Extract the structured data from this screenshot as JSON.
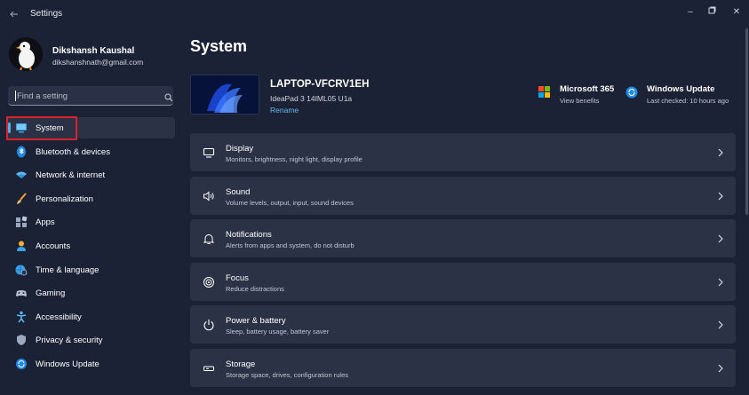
{
  "window": {
    "title": "Settings",
    "controls": {
      "minimize": "–",
      "maximize": "▢",
      "close": "✕"
    }
  },
  "profile": {
    "name": "Dikshansh Kaushal",
    "email": "dikshanshnath@gmail.com"
  },
  "search": {
    "placeholder": "Find a setting"
  },
  "sidebar": {
    "items": [
      {
        "label": "System",
        "icon": "system-icon",
        "selected": true
      },
      {
        "label": "Bluetooth & devices",
        "icon": "bluetooth-icon"
      },
      {
        "label": "Network & internet",
        "icon": "wifi-icon"
      },
      {
        "label": "Personalization",
        "icon": "brush-icon"
      },
      {
        "label": "Apps",
        "icon": "apps-icon"
      },
      {
        "label": "Accounts",
        "icon": "person-icon"
      },
      {
        "label": "Time & language",
        "icon": "globe-clock-icon"
      },
      {
        "label": "Gaming",
        "icon": "gamepad-icon"
      },
      {
        "label": "Accessibility",
        "icon": "accessibility-icon"
      },
      {
        "label": "Privacy & security",
        "icon": "shield-icon"
      },
      {
        "label": "Windows Update",
        "icon": "windows-update-icon"
      }
    ]
  },
  "main": {
    "title": "System",
    "device": {
      "name": "LAPTOP-VFCRV1EH",
      "model": "IdeaPad 3 14IML05 U1a",
      "rename": "Rename"
    },
    "microsoft365": {
      "title": "Microsoft 365",
      "subtitle": "View benefits"
    },
    "windows_update": {
      "title": "Windows Update",
      "subtitle": "Last checked: 10 hours ago"
    },
    "cards": [
      {
        "title": "Display",
        "subtitle": "Monitors, brightness, night light, display profile",
        "icon": "monitor-icon"
      },
      {
        "title": "Sound",
        "subtitle": "Volume levels, output, input, sound devices",
        "icon": "speaker-icon"
      },
      {
        "title": "Notifications",
        "subtitle": "Alerts from apps and system, do not disturb",
        "icon": "bell-icon"
      },
      {
        "title": "Focus",
        "subtitle": "Reduce distractions",
        "icon": "focus-icon"
      },
      {
        "title": "Power & battery",
        "subtitle": "Sleep, battery usage, battery saver",
        "icon": "power-icon"
      },
      {
        "title": "Storage",
        "subtitle": "Storage space, drives, configuration rules",
        "icon": "storage-icon"
      }
    ]
  },
  "colors": {
    "background": "#1c2235",
    "card": "#2b3245",
    "accent": "#4ab0f0",
    "highlight": "#d9222a"
  }
}
